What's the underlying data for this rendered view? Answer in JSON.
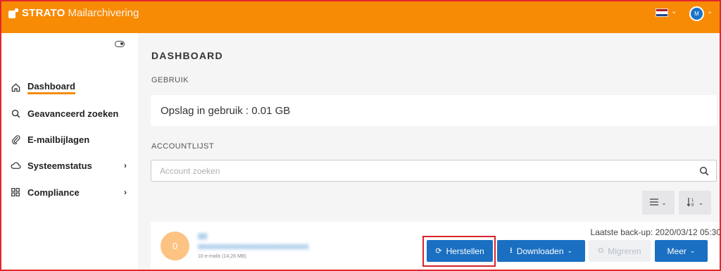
{
  "topbar": {
    "brand_bold": "STRATO",
    "brand_light": "Mailarchivering",
    "user_initial": "M"
  },
  "sidebar": {
    "items": [
      {
        "label": "Dashboard",
        "icon": "home-icon",
        "active": true
      },
      {
        "label": "Geavanceerd zoeken",
        "icon": "search-icon"
      },
      {
        "label": "E-mailbijlagen",
        "icon": "paperclip-icon"
      },
      {
        "label": "Systeemstatus",
        "icon": "cloud-icon",
        "caret": "›"
      },
      {
        "label": "Compliance",
        "icon": "grid-icon",
        "caret": "›"
      }
    ]
  },
  "main": {
    "title": "DASHBOARD",
    "usage_label": "GEBRUIK",
    "usage_text": "Opslag in gebruik : 0.01 GB",
    "account_list_label": "ACCOUNTLIJST",
    "search_placeholder": "Account zoeken"
  },
  "account": {
    "avatar_text": "0",
    "name": "00",
    "email": "00000000000000000000000000",
    "meta": "10 e-mails (14,26 MB)",
    "last_backup": "Laatste back-up: 2020/03/12 05:30",
    "buttons": {
      "restore": "Herstellen",
      "download": "Downloaden",
      "migrate": "Migreren",
      "more": "Meer"
    }
  },
  "colors": {
    "brand_orange": "#f88b06",
    "primary_blue": "#1a6fc2",
    "highlight_red": "#d9232a"
  }
}
